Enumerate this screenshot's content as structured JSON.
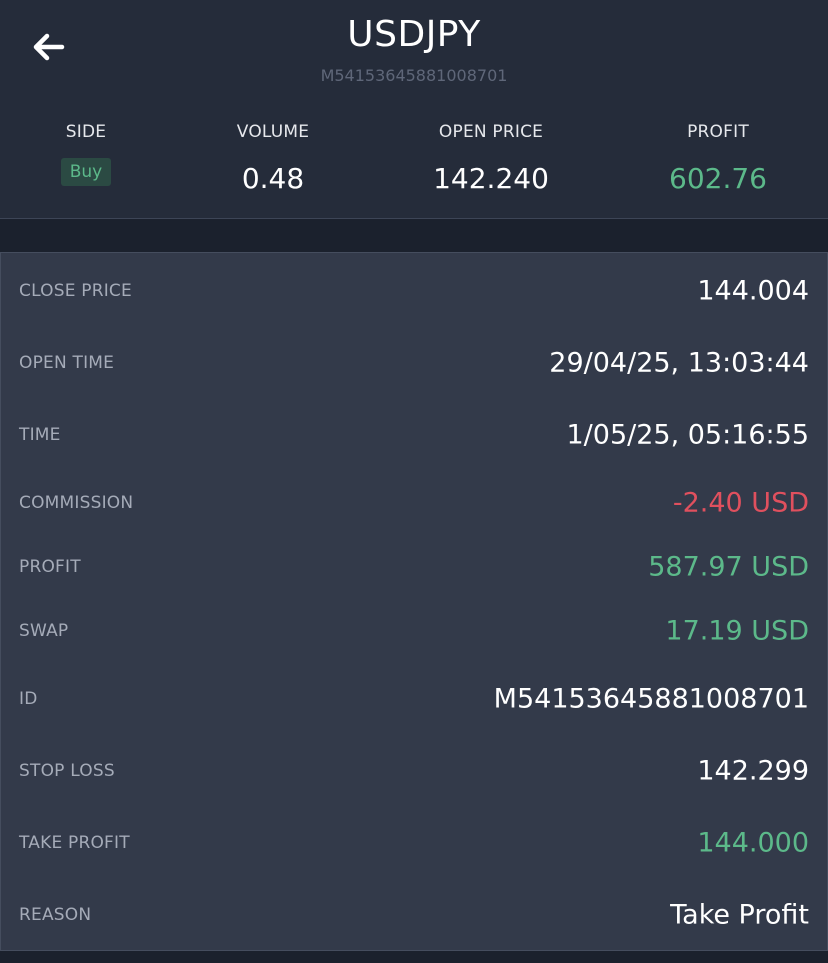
{
  "header": {
    "title": "USDJPY",
    "subtitle": "M54153645881008701",
    "back_icon": "arrow-left-icon"
  },
  "summary": {
    "side": {
      "label": "SIDE",
      "value": "Buy"
    },
    "volume": {
      "label": "VOLUME",
      "value": "0.48"
    },
    "open_price": {
      "label": "OPEN PRICE",
      "value": "142.240"
    },
    "profit": {
      "label": "PROFIT",
      "value": "602.76"
    }
  },
  "details": {
    "close_price": {
      "label": "CLOSE PRICE",
      "value": "144.004"
    },
    "open_time": {
      "label": "OPEN TIME",
      "value": "29/04/25, 13:03:44"
    },
    "time": {
      "label": "TIME",
      "value": "1/05/25, 05:16:55"
    },
    "commission": {
      "label": "COMMISSION",
      "value": "-2.40 USD"
    },
    "profit": {
      "label": "PROFIT",
      "value": "587.97 USD"
    },
    "swap": {
      "label": "SWAP",
      "value": "17.19 USD"
    },
    "id": {
      "label": "ID",
      "value": "M54153645881008701"
    },
    "stop_loss": {
      "label": "STOP LOSS",
      "value": "142.299"
    },
    "take_profit": {
      "label": "TAKE PROFIT",
      "value": "144.000"
    },
    "reason": {
      "label": "REASON",
      "value": "Take Profit"
    }
  },
  "colors": {
    "positive": "#5cb98a",
    "negative": "#e0505e",
    "background": "#252c3a",
    "card": "#333a4a"
  }
}
